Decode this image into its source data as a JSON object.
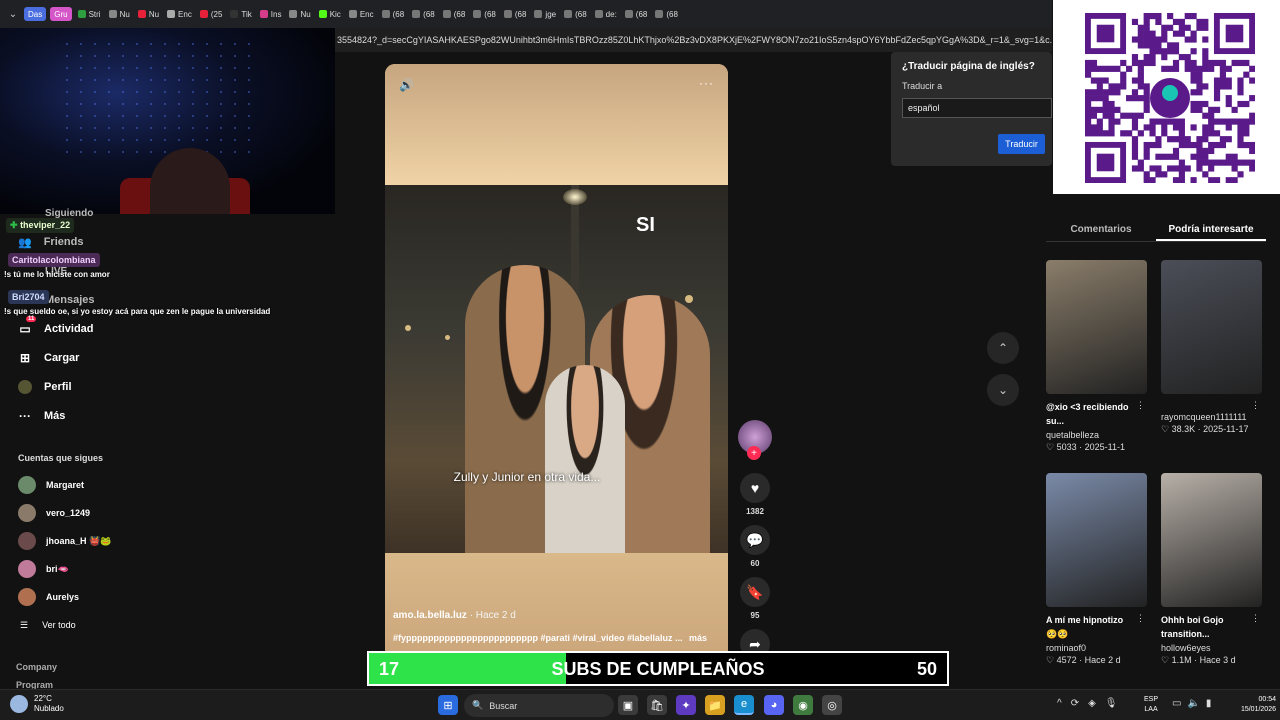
{
  "browser": {
    "group_tabs": [
      {
        "label": "Das",
        "color": "#4a6ee0"
      },
      {
        "label": "Gru",
        "color": "#d456c8"
      }
    ],
    "tabs": [
      "Stri",
      "Nu",
      "Nu",
      "Enc",
      "(25",
      "Tik",
      "Ins",
      "Nu",
      "Kic",
      "Enc",
      "(68",
      "(68",
      "(68",
      "(68",
      "(68",
      "jge",
      "(68",
      "de:",
      "(68",
      "(68"
    ],
    "url": "3554824?_d=secCgYIASAHKAESPgo82WUnihbt3m6HmIsTBROzz85Z0LhKThjxo%2Bz3vDX8PKXjE%2FWY8ON7zo21IoS5zn4spOY6YbbFdZec5qpYGgA%3D&_r=1&_svg=1&c..."
  },
  "translate_popup": {
    "title": "¿Traducir página de inglés?",
    "translate_to_label": "Traducir a",
    "language": "español",
    "translate_button": "Traducir"
  },
  "chat": {
    "messages": [
      {
        "user": "theviper_22",
        "color": "#2fc04a",
        "text": ""
      },
      {
        "user": "Caritolacolombiana",
        "color": "#c94ad8",
        "text": "!s tú me lo hiciste con amor"
      },
      {
        "user": "Bri2704",
        "color": "#4a79e0",
        "text": "!s que sueldo oe, si yo estoy acá para que zen le pague la universidad"
      }
    ]
  },
  "sidebar": {
    "nav_partial": [
      "Siguiendo",
      "Friends",
      "LIVE",
      "Mensajes"
    ],
    "nav": [
      {
        "label": "Actividad",
        "icon": "inbox-icon",
        "badge": "11"
      },
      {
        "label": "Cargar",
        "icon": "plus-square-icon"
      },
      {
        "label": "Perfil",
        "icon": "profile-icon"
      },
      {
        "label": "Más",
        "icon": "more-dots-icon"
      }
    ],
    "following_title": "Cuentas que sigues",
    "following": [
      {
        "name": "Margaret",
        "color": "#6a8a6a"
      },
      {
        "name": "vero_1249",
        "color": "#8a7a6a"
      },
      {
        "name": "jhoana_H 👹🐸",
        "color": "#6a4a4a"
      },
      {
        "name": "bri🫦",
        "color": "#c07a9a"
      },
      {
        "name": "Aurelys",
        "color": "#b07050"
      }
    ],
    "see_all": "Ver todo",
    "footer": [
      "Company",
      "Program"
    ]
  },
  "video": {
    "overlay_text": "SI",
    "caption": "Zully y Junior en otra vida...",
    "author": "amo.la.bella.luz",
    "posted": "· Hace 2 d",
    "hashtags": "#fypppppppppppppppppppppppp #parati #viral_video #labellaluz ...",
    "more": "más"
  },
  "actions": {
    "likes": "1382",
    "comments": "60",
    "saves": "95"
  },
  "right_panel": {
    "tabs": [
      "Comentarios",
      "Podría interesarte"
    ],
    "active_tab": 1,
    "recommendations": [
      {
        "title": "@xio <3 recibiendo su...",
        "user": "quetalbelleza",
        "likes": "5033",
        "when": "2025-11-1",
        "thumb": "#8a7d6a"
      },
      {
        "title": "",
        "user": "rayomcqueen1111111",
        "likes": "38.3K",
        "when": "2025-11-17",
        "thumb": "#4b4e58"
      },
      {
        "title": "A mí me hipnotizo 🥺🥺",
        "user": "rominaof0",
        "likes": "4572",
        "when": "Hace 2 d",
        "thumb": "#7a8aa8"
      },
      {
        "title": "Ohhh boi Gojo transition...",
        "user": "hollow6eyes",
        "likes": "1.1M",
        "when": "Hace 3 d",
        "thumb": "#b8b0a8"
      }
    ]
  },
  "subs_goal": {
    "current": "17",
    "label": "SUBS DE CUMPLEAÑOS",
    "goal": "50",
    "progress": 0.34
  },
  "taskbar": {
    "temperature": "22°C",
    "weather": "Nublado",
    "search_placeholder": "Buscar",
    "lang_line1": "ESP",
    "lang_line2": "LAA",
    "time": "00:54",
    "date": "15/01/2026"
  }
}
